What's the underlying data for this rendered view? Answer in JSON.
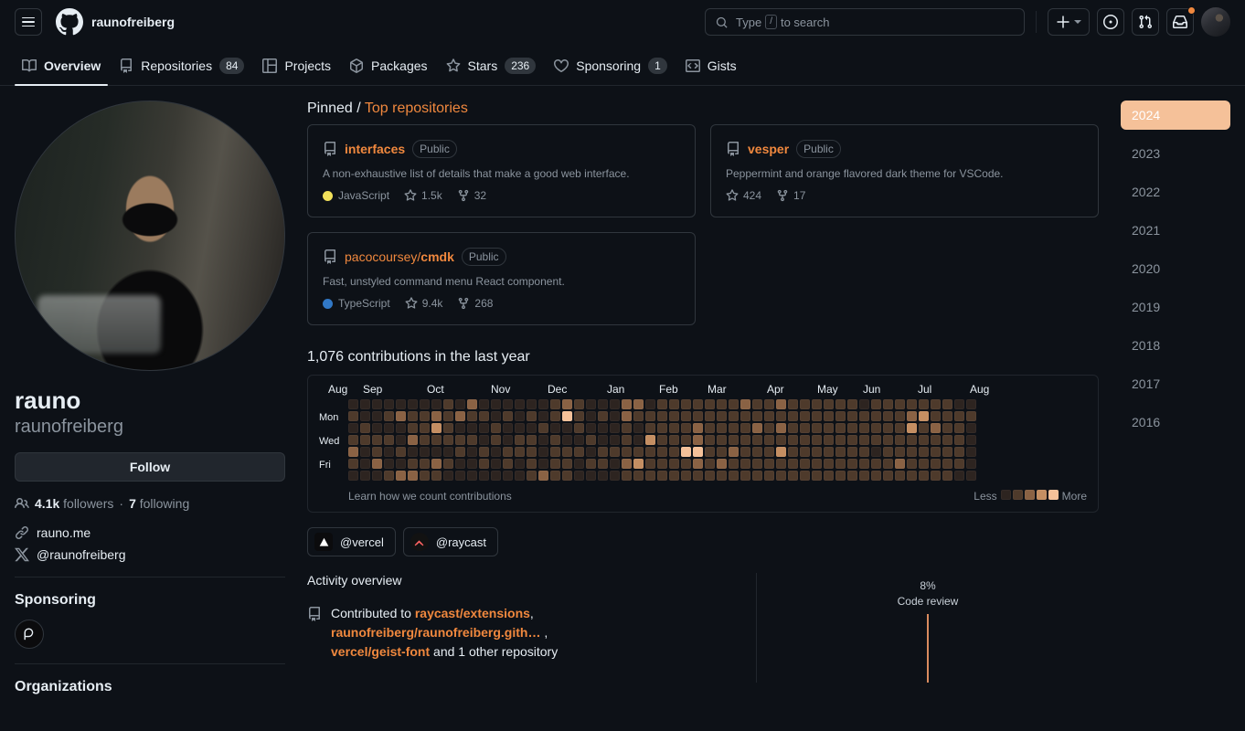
{
  "header": {
    "menu_icon": "hamburger-icon",
    "logo_icon": "github-mark-icon",
    "owner": "raunofreiberg",
    "search": {
      "placeholder_before": "Type",
      "key": "/",
      "placeholder_after": "to search",
      "icon": "search-icon"
    },
    "create_button": {
      "icon": "plus-icon",
      "caret": "chevron-down-icon"
    },
    "issues_button": {
      "icon": "issue-opened-icon"
    },
    "pulls_button": {
      "icon": "git-pull-request-icon"
    },
    "inbox_button": {
      "icon": "inbox-icon",
      "has_notification": true
    },
    "avatar": {
      "icon": "user-avatar"
    }
  },
  "tabs": [
    {
      "label": "Overview",
      "icon": "book-icon",
      "count": null,
      "active": true
    },
    {
      "label": "Repositories",
      "icon": "repo-icon",
      "count": "84",
      "active": false
    },
    {
      "label": "Projects",
      "icon": "project-icon",
      "count": null,
      "active": false
    },
    {
      "label": "Packages",
      "icon": "package-icon",
      "count": null,
      "active": false
    },
    {
      "label": "Stars",
      "icon": "star-icon",
      "count": "236",
      "active": false
    },
    {
      "label": "Sponsoring",
      "icon": "heart-icon",
      "count": "1",
      "active": false
    },
    {
      "label": "Gists",
      "icon": "code-icon",
      "count": null,
      "active": false
    }
  ],
  "profile": {
    "avatar_alt": "rauno profile photo",
    "name": "rauno",
    "login": "raunofreiberg",
    "follow_label": "Follow",
    "followers_count": "4.1k",
    "followers_label": "followers",
    "separator": "·",
    "following_count": "7",
    "following_label": "following",
    "links": [
      {
        "icon": "link-icon",
        "text": "rauno.me"
      },
      {
        "icon": "x-twitter-icon",
        "text": "@raunofreiberg"
      }
    ],
    "sponsoring_title": "Sponsoring",
    "sponsoring_avatar_icon": "polar-logo-icon",
    "organizations_title": "Organizations"
  },
  "pinned": {
    "heading_static": "Pinned / ",
    "heading_link": "Top repositories",
    "repos": [
      {
        "icon": "repo-icon",
        "owner_prefix": "",
        "name": "interfaces",
        "visibility": "Public",
        "description": "A non-exhaustive list of details that make a good web interface.",
        "language": "JavaScript",
        "language_color": "#f1e05a",
        "stars": "1.5k",
        "forks": "32"
      },
      {
        "icon": "repo-icon",
        "owner_prefix": "",
        "name": "vesper",
        "visibility": "Public",
        "description": "Peppermint and orange flavored dark theme for VSCode.",
        "language": null,
        "language_color": null,
        "stars": "424",
        "forks": "17"
      },
      {
        "icon": "repo-icon",
        "owner_prefix": "pacocoursey/",
        "name": "cmdk",
        "visibility": "Public",
        "description": "Fast, unstyled command menu React component.",
        "language": "TypeScript",
        "language_color": "#3178c6",
        "stars": "9.4k",
        "forks": "268"
      }
    ]
  },
  "contributions": {
    "heading": "1,076 contributions in the last year",
    "total": "1,076",
    "months": [
      "Aug",
      "Sep",
      "Oct",
      "Nov",
      "Dec",
      "Jan",
      "Feb",
      "Mar",
      "Apr",
      "May",
      "Jun",
      "Jul",
      "Aug"
    ],
    "weekdays": [
      "",
      "Mon",
      "",
      "Wed",
      "",
      "Fri",
      ""
    ],
    "learn_link": "Learn how we count contributions",
    "legend_less": "Less",
    "legend_more": "More",
    "legend_colors": [
      "#2d2420",
      "#4e3a2b",
      "#8a6244",
      "#c48e62",
      "#f5c199"
    ]
  },
  "organizations": [
    {
      "name": "@vercel",
      "logo": "vercel-triangle-icon"
    },
    {
      "name": "@raycast",
      "logo": "raycast-logo-icon"
    }
  ],
  "activity": {
    "title": "Activity overview",
    "item_icon": "repo-icon",
    "text_prefix": "Contributed to ",
    "repos": [
      "raycast/extensions",
      "raunofreiberg/raunofreiberg.gith…",
      "vercel/geist-font"
    ],
    "text_suffix": " and 1 other repository",
    "radar": {
      "percent": "8%",
      "label": "Code review",
      "color": "#d98b5f"
    }
  },
  "years": [
    {
      "label": "2024",
      "selected": true
    },
    {
      "label": "2023",
      "selected": false
    },
    {
      "label": "2022",
      "selected": false
    },
    {
      "label": "2021",
      "selected": false
    },
    {
      "label": "2020",
      "selected": false
    },
    {
      "label": "2019",
      "selected": false
    },
    {
      "label": "2018",
      "selected": false
    },
    {
      "label": "2017",
      "selected": false
    },
    {
      "label": "2016",
      "selected": false
    }
  ],
  "chart_data": {
    "type": "heatmap",
    "title": "1,076 contributions in the last year",
    "weeks": 53,
    "days_per_week": 7,
    "level_colors": [
      "#2d2420",
      "#4e3a2b",
      "#8a6244",
      "#c48e62",
      "#f5c199"
    ],
    "level_labels": [
      "Less",
      "",
      "",
      "",
      "More"
    ],
    "x_tick_labels": [
      "Aug",
      "Sep",
      "Oct",
      "Nov",
      "Dec",
      "Jan",
      "Feb",
      "Mar",
      "Apr",
      "May",
      "Jun",
      "Jul",
      "Aug"
    ],
    "y_tick_labels": [
      "Mon",
      "Wed",
      "Fri"
    ],
    "levels": [
      [
        0,
        1,
        0,
        1,
        2,
        1,
        0
      ],
      [
        0,
        0,
        1,
        1,
        0,
        0,
        0
      ],
      [
        0,
        0,
        0,
        1,
        1,
        2,
        0
      ],
      [
        0,
        1,
        0,
        1,
        0,
        0,
        1
      ],
      [
        0,
        2,
        0,
        0,
        1,
        0,
        2
      ],
      [
        0,
        1,
        1,
        2,
        0,
        1,
        2
      ],
      [
        0,
        1,
        1,
        1,
        0,
        1,
        1
      ],
      [
        0,
        2,
        3,
        1,
        0,
        2,
        1
      ],
      [
        1,
        1,
        1,
        1,
        0,
        1,
        0
      ],
      [
        0,
        2,
        0,
        1,
        1,
        0,
        0
      ],
      [
        2,
        1,
        0,
        1,
        0,
        0,
        0
      ],
      [
        0,
        1,
        0,
        0,
        1,
        1,
        0
      ],
      [
        0,
        0,
        1,
        1,
        0,
        0,
        0
      ],
      [
        0,
        1,
        0,
        0,
        1,
        1,
        0
      ],
      [
        0,
        0,
        0,
        1,
        1,
        0,
        0
      ],
      [
        0,
        1,
        0,
        1,
        1,
        1,
        1
      ],
      [
        0,
        0,
        1,
        0,
        0,
        0,
        2
      ],
      [
        1,
        1,
        0,
        1,
        1,
        1,
        1
      ],
      [
        2,
        4,
        0,
        0,
        1,
        1,
        1
      ],
      [
        1,
        1,
        1,
        0,
        1,
        0,
        0
      ],
      [
        0,
        0,
        0,
        1,
        0,
        1,
        0
      ],
      [
        0,
        1,
        0,
        0,
        1,
        1,
        0
      ],
      [
        0,
        0,
        0,
        0,
        1,
        0,
        0
      ],
      [
        2,
        2,
        1,
        1,
        1,
        2,
        1
      ],
      [
        2,
        1,
        0,
        0,
        1,
        3,
        1
      ],
      [
        0,
        1,
        1,
        3,
        1,
        1,
        1
      ],
      [
        1,
        1,
        1,
        1,
        1,
        1,
        1
      ],
      [
        1,
        1,
        1,
        1,
        1,
        1,
        1
      ],
      [
        1,
        1,
        1,
        1,
        4,
        1,
        1
      ],
      [
        1,
        1,
        2,
        2,
        4,
        2,
        1
      ],
      [
        1,
        1,
        1,
        1,
        1,
        1,
        1
      ],
      [
        1,
        1,
        1,
        1,
        1,
        2,
        1
      ],
      [
        1,
        1,
        1,
        1,
        2,
        1,
        1
      ],
      [
        2,
        1,
        1,
        1,
        1,
        1,
        1
      ],
      [
        1,
        1,
        2,
        1,
        1,
        1,
        1
      ],
      [
        1,
        1,
        1,
        1,
        1,
        1,
        1
      ],
      [
        2,
        1,
        2,
        1,
        3,
        1,
        1
      ],
      [
        1,
        1,
        1,
        1,
        1,
        1,
        1
      ],
      [
        1,
        1,
        1,
        1,
        1,
        1,
        1
      ],
      [
        1,
        1,
        1,
        1,
        1,
        1,
        1
      ],
      [
        1,
        1,
        1,
        1,
        1,
        1,
        1
      ],
      [
        1,
        1,
        1,
        1,
        1,
        1,
        1
      ],
      [
        1,
        1,
        1,
        1,
        1,
        1,
        1
      ],
      [
        0,
        1,
        1,
        1,
        1,
        1,
        1
      ],
      [
        1,
        1,
        1,
        1,
        0,
        1,
        1
      ],
      [
        1,
        1,
        1,
        1,
        1,
        1,
        1
      ],
      [
        1,
        1,
        1,
        1,
        1,
        2,
        1
      ],
      [
        1,
        2,
        3,
        1,
        1,
        1,
        1
      ],
      [
        1,
        3,
        1,
        1,
        1,
        1,
        1
      ],
      [
        1,
        1,
        2,
        1,
        1,
        1,
        1
      ],
      [
        1,
        1,
        1,
        1,
        1,
        1,
        1
      ],
      [
        0,
        1,
        1,
        1,
        1,
        1,
        0
      ],
      [
        0,
        1,
        0,
        0,
        0,
        0,
        0
      ]
    ]
  }
}
